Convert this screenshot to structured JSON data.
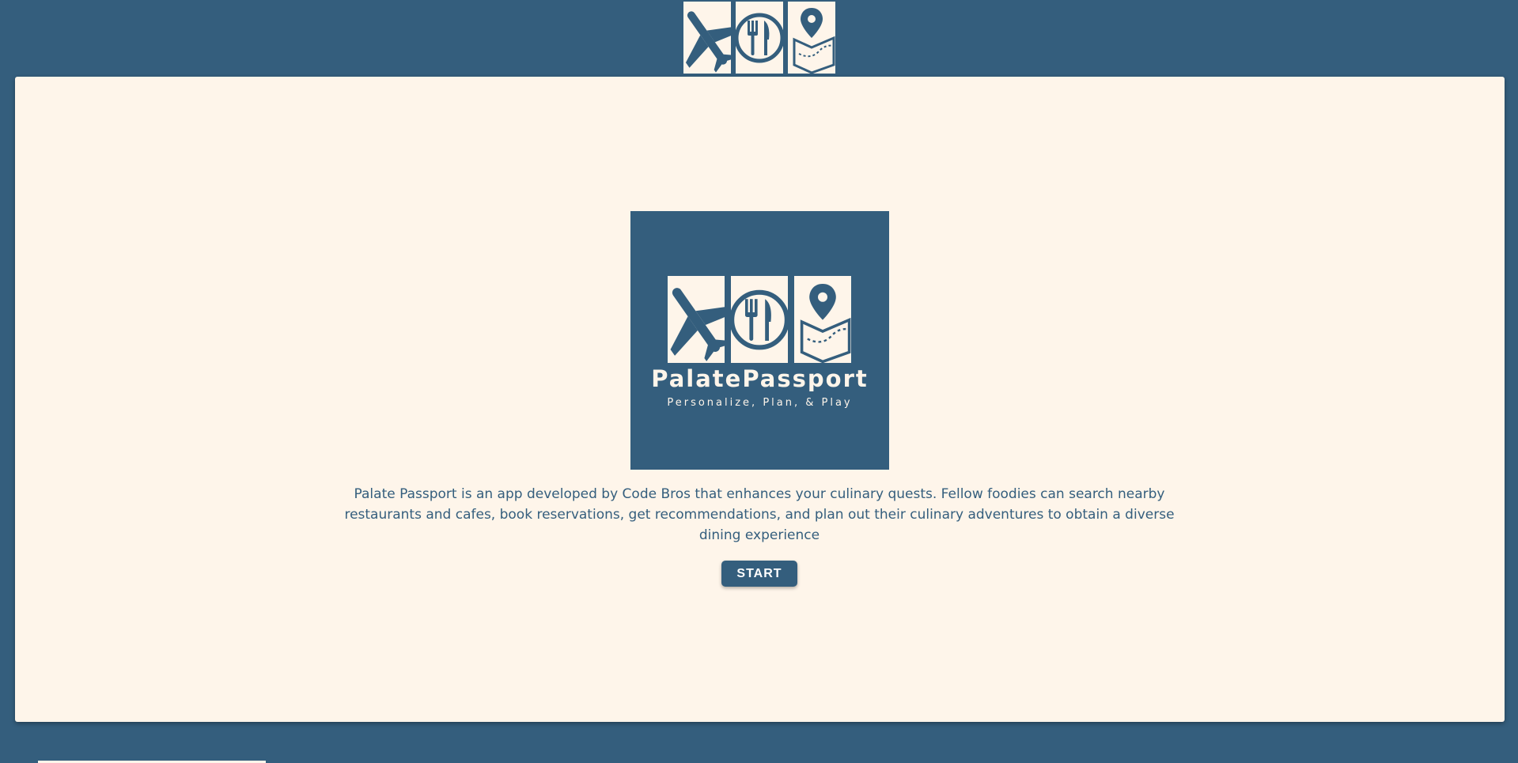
{
  "header": {
    "logo_icons": [
      "airplane-icon",
      "fork-knife-plate-icon",
      "map-pin-icon"
    ]
  },
  "hero": {
    "brand_name": "PalatePassport",
    "tagline": "Personalize, Plan, & Play",
    "logo_icons": [
      "airplane-icon",
      "fork-knife-plate-icon",
      "map-pin-icon"
    ]
  },
  "main": {
    "description": "Palate Passport is an app developed by Code Bros that enhances your culinary quests. Fellow foodies can search nearby restaurants and cafes, book reservations, get recommendations, and plan out their culinary adventures to obtain a diverse dining experience",
    "start_label": "START"
  },
  "colors": {
    "primary": "#345e7d",
    "background": "#fef5ea",
    "button_text": "#ffffff"
  }
}
